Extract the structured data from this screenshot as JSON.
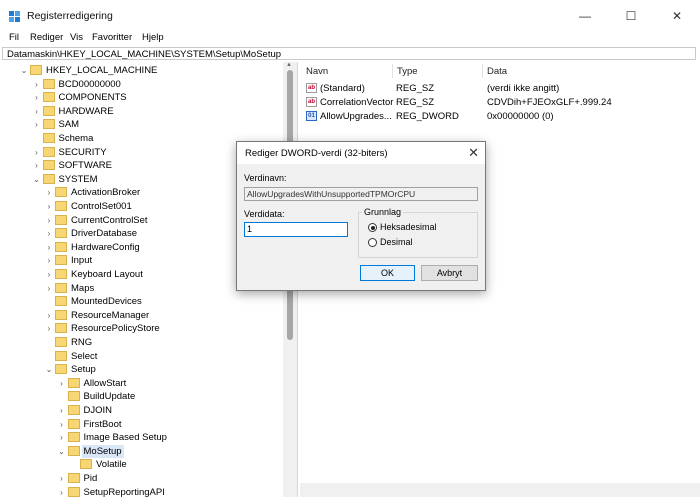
{
  "window": {
    "title": "Registerredigering",
    "minimize_glyph": "—",
    "maximize_glyph": "☐",
    "close_glyph": "✕"
  },
  "menu": [
    "Fil",
    "Rediger",
    "Vis",
    "Favoritter",
    "Hjelp"
  ],
  "address": "Datamaskin\\HKEY_LOCAL_MACHINE\\SYSTEM\\Setup\\MoSetup",
  "tree": [
    {
      "label": "HKEY_LOCAL_MACHINE",
      "depth": 0,
      "expand": "open"
    },
    {
      "label": "BCD00000000",
      "depth": 1,
      "expand": "closed"
    },
    {
      "label": "COMPONENTS",
      "depth": 1,
      "expand": "closed"
    },
    {
      "label": "HARDWARE",
      "depth": 1,
      "expand": "closed"
    },
    {
      "label": "SAM",
      "depth": 1,
      "expand": "closed"
    },
    {
      "label": "Schema",
      "depth": 1,
      "expand": "none"
    },
    {
      "label": "SECURITY",
      "depth": 1,
      "expand": "closed"
    },
    {
      "label": "SOFTWARE",
      "depth": 1,
      "expand": "closed"
    },
    {
      "label": "SYSTEM",
      "depth": 1,
      "expand": "open"
    },
    {
      "label": "ActivationBroker",
      "depth": 2,
      "expand": "closed"
    },
    {
      "label": "ControlSet001",
      "depth": 2,
      "expand": "closed"
    },
    {
      "label": "CurrentControlSet",
      "depth": 2,
      "expand": "closed"
    },
    {
      "label": "DriverDatabase",
      "depth": 2,
      "expand": "closed"
    },
    {
      "label": "HardwareConfig",
      "depth": 2,
      "expand": "closed"
    },
    {
      "label": "Input",
      "depth": 2,
      "expand": "closed"
    },
    {
      "label": "Keyboard Layout",
      "depth": 2,
      "expand": "closed"
    },
    {
      "label": "Maps",
      "depth": 2,
      "expand": "closed"
    },
    {
      "label": "MountedDevices",
      "depth": 2,
      "expand": "none"
    },
    {
      "label": "ResourceManager",
      "depth": 2,
      "expand": "closed"
    },
    {
      "label": "ResourcePolicyStore",
      "depth": 2,
      "expand": "closed"
    },
    {
      "label": "RNG",
      "depth": 2,
      "expand": "none"
    },
    {
      "label": "Select",
      "depth": 2,
      "expand": "none"
    },
    {
      "label": "Setup",
      "depth": 2,
      "expand": "open"
    },
    {
      "label": "AllowStart",
      "depth": 3,
      "expand": "closed"
    },
    {
      "label": "BuildUpdate",
      "depth": 3,
      "expand": "none"
    },
    {
      "label": "DJOIN",
      "depth": 3,
      "expand": "closed"
    },
    {
      "label": "FirstBoot",
      "depth": 3,
      "expand": "closed"
    },
    {
      "label": "Image Based Setup",
      "depth": 3,
      "expand": "closed"
    },
    {
      "label": "MoSetup",
      "depth": 3,
      "expand": "open",
      "selected": true
    },
    {
      "label": "Volatile",
      "depth": 4,
      "expand": "none"
    },
    {
      "label": "Pid",
      "depth": 3,
      "expand": "closed"
    },
    {
      "label": "SetupReportingAPI",
      "depth": 3,
      "expand": "closed"
    }
  ],
  "columns": {
    "name": "Navn",
    "type": "Type",
    "data": "Data"
  },
  "values": [
    {
      "name": "(Standard)",
      "type": "REG_SZ",
      "data": "(verdi ikke angitt)",
      "kind": "sz"
    },
    {
      "name": "CorrelationVector",
      "type": "REG_SZ",
      "data": "CDVDih+FJEOxGLF+.999.24",
      "kind": "sz"
    },
    {
      "name": "AllowUpgrades...",
      "type": "REG_DWORD",
      "data": "0x00000000 (0)",
      "kind": "dword"
    }
  ],
  "dialog": {
    "title": "Rediger DWORD-verdi (32-biters)",
    "value_name_label": "Verdinavn:",
    "value_name": "AllowUpgradesWithUnsupportedTPMOrCPU",
    "value_data_label": "Verdidata:",
    "value_data": "1",
    "base_label": "Grunnlag",
    "hex_label": "Heksadesimal",
    "dec_label": "Desimal",
    "ok": "OK",
    "cancel": "Avbryt"
  },
  "colors": {
    "accent": "#0078d7",
    "folder": "#f7d774"
  }
}
